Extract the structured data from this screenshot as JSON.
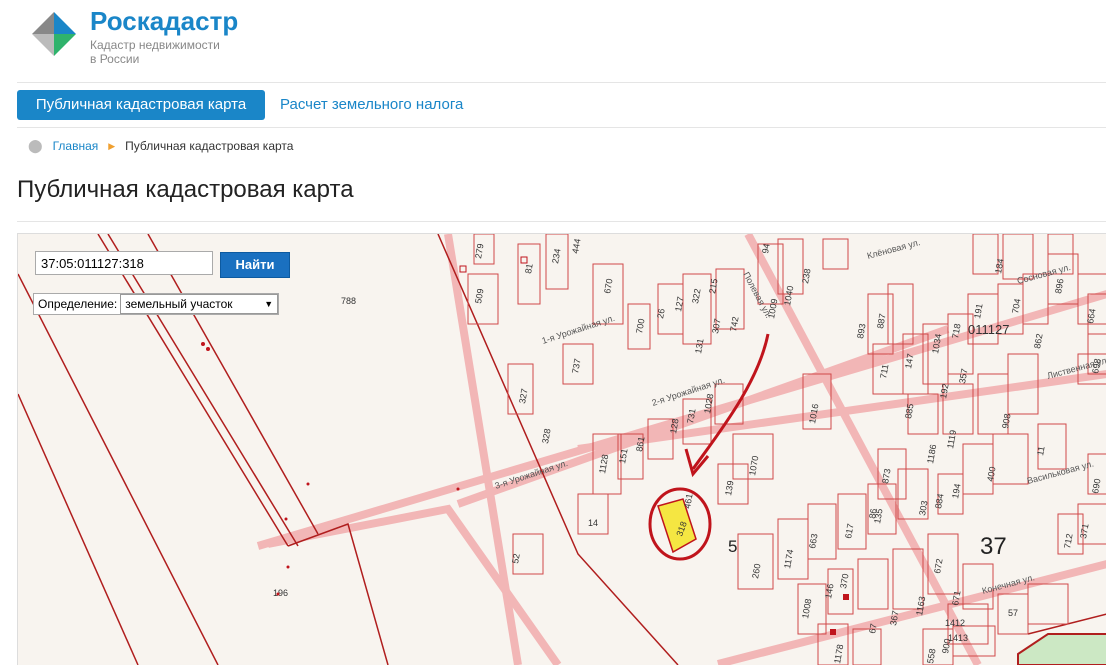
{
  "brand": {
    "name": "Роскадастр",
    "sub_line1": "Кадастр недвижимости",
    "sub_line2": "в России"
  },
  "nav": {
    "active": "Публичная кадастровая карта",
    "link": "Расчет земельного налога"
  },
  "breadcrumb": {
    "home": "Главная",
    "current": "Публичная кадастровая карта"
  },
  "page": {
    "title": "Публичная кадастровая карта"
  },
  "map": {
    "search_value": "37:05:011127:318",
    "search_button": "Найти",
    "definition_label": "Определение:",
    "definition_value": "земельный участок",
    "quarter_label": "011127",
    "district_label": "37",
    "block_label": "5",
    "highlighted_parcel": "318",
    "streets": {
      "s1": "1-я Урожайная ул.",
      "s2": "2-я Урожайная ул.",
      "s3": "3-я Урожайная ул.",
      "s4": "Клёновая ул.",
      "s5": "Сосновая ул.",
      "s6": "Лиственная ул.",
      "s7": "Васильковая ул.",
      "s8": "Конечная ул.",
      "s9": "Полевая ул."
    },
    "parcels": [
      "788",
      "196",
      "279",
      "81",
      "234",
      "444",
      "670",
      "509",
      "700",
      "26",
      "127",
      "322",
      "215",
      "742",
      "307",
      "131",
      "737",
      "327",
      "328",
      "1128",
      "151",
      "861",
      "128",
      "731",
      "1028",
      "1016",
      "14",
      "52",
      "139",
      "1070",
      "1009",
      "1040",
      "238",
      "94",
      "893",
      "887",
      "711",
      "147",
      "1034",
      "718",
      "191",
      "704",
      "862",
      "885",
      "192",
      "357",
      "908",
      "873",
      "1186",
      "1119",
      "400",
      "11",
      "86",
      "303",
      "884",
      "194",
      "371",
      "712",
      "260",
      "1174",
      "663",
      "617",
      "135",
      "672",
      "1008",
      "146",
      "370",
      "67",
      "367",
      "1163",
      "671",
      "57",
      "1412",
      "1413",
      "1178",
      "900",
      "558",
      "664",
      "896",
      "184",
      "698",
      "690",
      "461"
    ],
    "colors": {
      "parcel_line": "#c0392b",
      "road": "#f2b6b6",
      "highlight": "#f5e642",
      "annotation": "#c0141c"
    }
  }
}
